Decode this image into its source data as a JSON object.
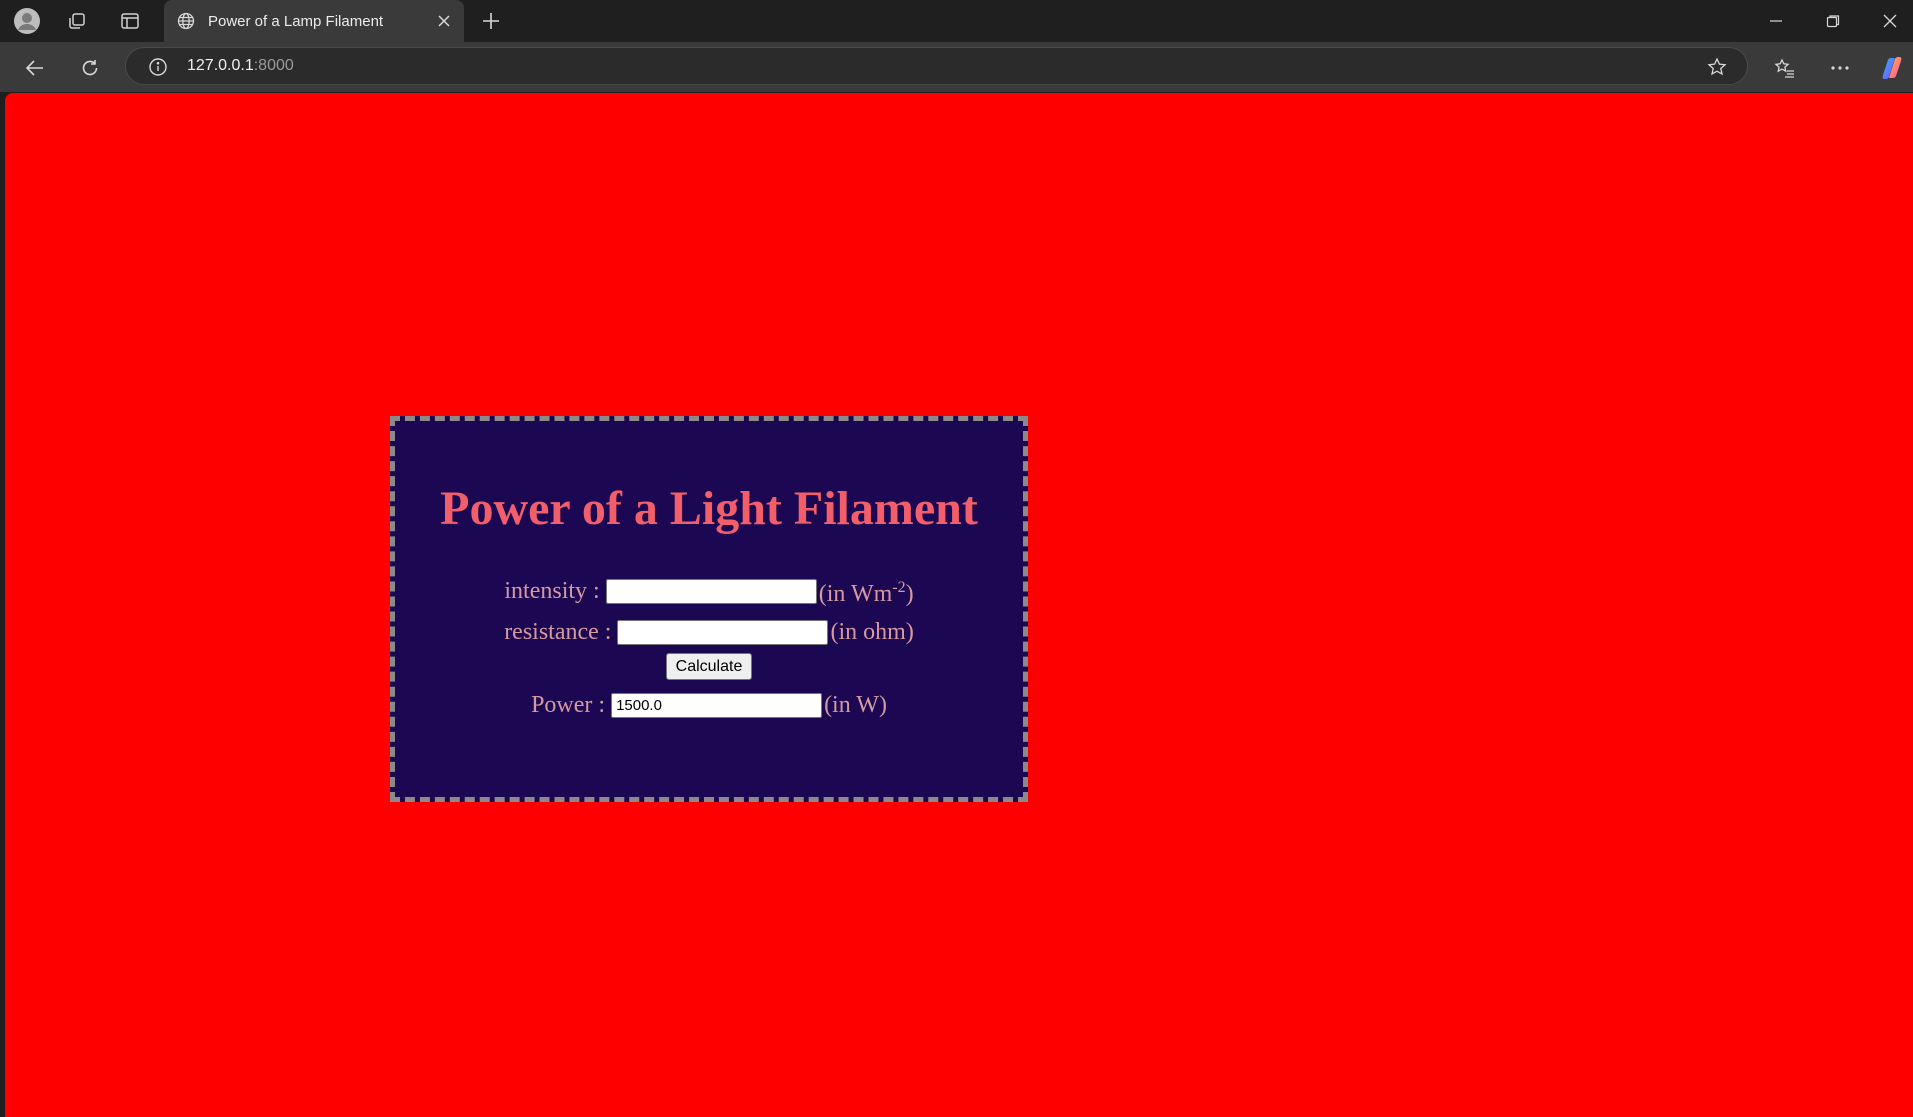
{
  "browser": {
    "tab_title": "Power of a Lamp Filament",
    "url_host": "127.0.0.1",
    "url_port": ":8000"
  },
  "page": {
    "heading": "Power of a Light Filament",
    "intensity": {
      "label": "intensity :",
      "value": "",
      "unit_prefix": "(in Wm",
      "unit_sup": "-2",
      "unit_suffix": ")"
    },
    "resistance": {
      "label": "resistance :",
      "value": "",
      "unit": "(in ohm)"
    },
    "calculate_label": "Calculate",
    "power": {
      "label": "Power :",
      "value": "1500.0",
      "unit": "(in W)"
    },
    "colors": {
      "background": "#ff0000",
      "card": "#1c0752",
      "heading": "#f25f6b",
      "label": "#d59aa0",
      "border": "#8a8a8a"
    }
  }
}
